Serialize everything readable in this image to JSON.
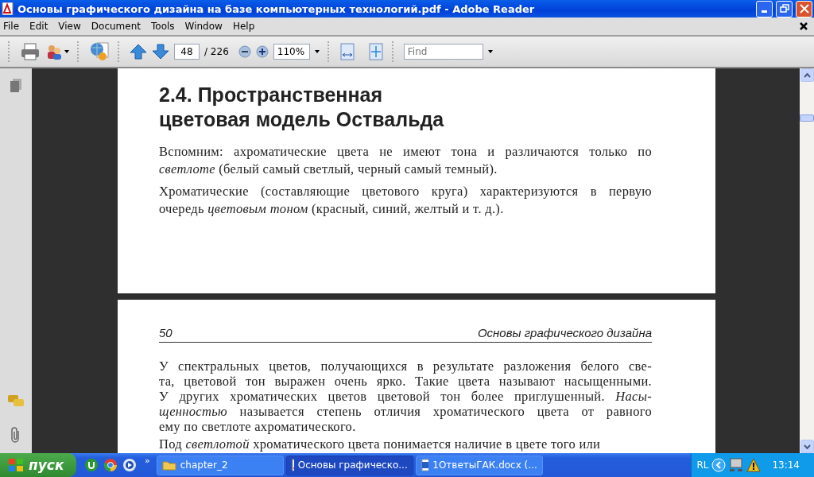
{
  "window": {
    "title": "Основы графического дизайна на базе компьютерных технологий.pdf - Adobe Reader"
  },
  "menu": [
    "File",
    "Edit",
    "View",
    "Document",
    "Tools",
    "Window",
    "Help"
  ],
  "toolbar": {
    "page": "48",
    "page_total": "/ 226",
    "zoom": "110%",
    "find": {
      "placeholder": "Find"
    }
  },
  "pages": [
    {
      "heading": [
        "2.4. Пространственная",
        "цветовая модель Оствальда"
      ],
      "paragraphs": [
        [
          "Вспомним: ахроматические цвета не имеют тона и различаются только по",
          "*светлоте* (белый самый светлый, черный самый темный)."
        ],
        [
          "Хроматические (составляющие цветового круга) характеризуются в первую",
          "очередь *цветовым тоном* (красный, синий, желтый и т. д.)."
        ]
      ]
    },
    {
      "page_number": "50",
      "running_title": "Основы графического дизайна",
      "paragraphs": [
        [
          "У спектральных цветов, получающихся в результате разложения белого све-",
          "та, цветовой тон выражен очень ярко. Такие цвета называют насыщенными.",
          "У других хроматических цветов цветовой тон более приглушенный. *Насы-*",
          "*щенностью* называется степень отличия хроматического цвета от равного",
          "ему по светлоте ахроматического."
        ],
        [
          "Под *светлотой* хроматического цвета понимается наличие в цвете того или"
        ]
      ]
    }
  ],
  "taskbar": {
    "start": "пуск",
    "more": "»",
    "tasks": [
      {
        "kind": "folder",
        "label": "chapter_2",
        "selected": false
      },
      {
        "kind": "pdf",
        "label": "Основы графическо...",
        "selected": true
      },
      {
        "kind": "word",
        "label": "1ОтветыГАК.docx (...",
        "selected": false
      }
    ],
    "language": "RL",
    "clock": "13:14"
  }
}
